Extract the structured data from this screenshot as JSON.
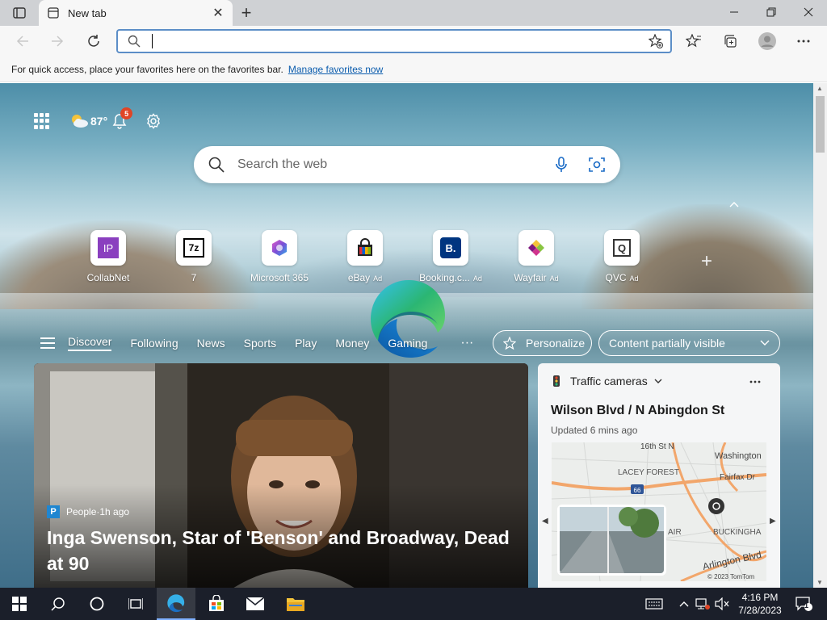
{
  "browser": {
    "tab_title": "New tab",
    "omnibox_value": "",
    "favorites_bar_message": "For quick access, place your favorites here on the favorites bar.",
    "favorites_bar_link": "Manage favorites now"
  },
  "ntp": {
    "weather_temp": "87°",
    "notification_count": "5",
    "search_placeholder": "Search the web",
    "tiles": [
      {
        "label": "CollabNet",
        "ad": "",
        "icon": "collabnet-icon",
        "color": "#8a3fbf",
        "glyph": "IP"
      },
      {
        "label": "7",
        "ad": "",
        "icon": "7zip-icon",
        "color": "#000000",
        "glyph": "7z"
      },
      {
        "label": "Microsoft 365",
        "ad": "",
        "icon": "microsoft-365-icon",
        "color": "#7b4fd6",
        "glyph": ""
      },
      {
        "label": "eBay",
        "ad": "Ad",
        "icon": "ebay-icon",
        "color": "#e53238",
        "glyph": ""
      },
      {
        "label": "Booking.c...",
        "ad": "Ad",
        "icon": "booking-icon",
        "color": "#003580",
        "glyph": "B."
      },
      {
        "label": "Wayfair",
        "ad": "Ad",
        "icon": "wayfair-icon",
        "color": "#7f187f",
        "glyph": ""
      },
      {
        "label": "QVC",
        "ad": "Ad",
        "icon": "qvc-icon",
        "color": "#333333",
        "glyph": "Q"
      }
    ],
    "feed_nav": [
      "Discover",
      "Following",
      "News",
      "Sports",
      "Play",
      "Money",
      "Gaming"
    ],
    "feed_more": "···",
    "personalize_label": "Personalize",
    "content_visibility_label": "Content partially visible",
    "hero": {
      "source": "People",
      "time": "1h ago",
      "source_sep": " · ",
      "title": "Inga Swenson, Star of 'Benson' and Broadway, Dead at 90"
    },
    "traffic": {
      "header": "Traffic cameras",
      "location": "Wilson Blvd / N Abingdon St",
      "updated": "Updated 6 mins ago",
      "map_labels": {
        "street_16th": "16th St N",
        "lacey_forest": "LACEY FOREST",
        "washington": "Washington",
        "fairfax": "Fairfax Dr",
        "route": "66",
        "air": "AIR",
        "buckingham": "BUCKINGHA",
        "arlington": "Arlington Blvd",
        "copyright": "© 2023 TomTom"
      }
    }
  },
  "taskbar": {
    "time": "4:16 PM",
    "date": "7/28/2023",
    "notification_count": "1"
  }
}
